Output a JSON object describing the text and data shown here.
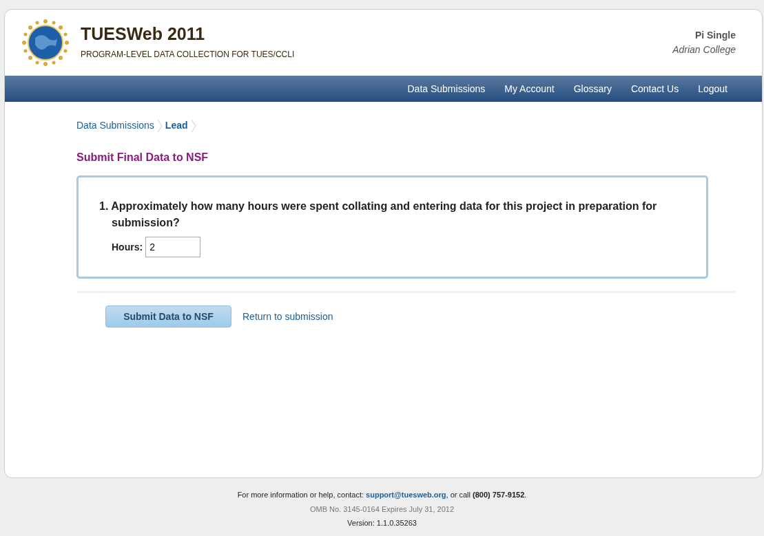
{
  "header": {
    "title": "TUESWeb 2011",
    "subtitle": "PROGRAM-LEVEL DATA COLLECTION FOR TUES/CCLI",
    "user_name": "Pi Single",
    "institution": "Adrian College"
  },
  "nav": [
    "Data Submissions",
    "My Account",
    "Glossary",
    "Contact Us",
    "Logout"
  ],
  "breadcrumb": [
    {
      "label": "Data Submissions",
      "selected": false
    },
    {
      "label": "Lead",
      "selected": true
    }
  ],
  "page_title": "Submit Final Data to NSF",
  "question": {
    "number": "1.",
    "text": "Approximately how many hours were spent collating and entering data for this project in preparation for submission?",
    "field_label": "Hours:",
    "value": "2"
  },
  "actions": {
    "submit": "Submit Data to NSF",
    "return_link": "Return to submission"
  },
  "footer": {
    "contact_before": "For more information or help, contact:",
    "email": "support@tuesweb.org",
    "contact_after": ", or call **(800) 757-9152**.",
    "omb": "OMB No. 3145-0164 Expires July 31, 2012",
    "version": "Version: 1.1.0.35263"
  }
}
